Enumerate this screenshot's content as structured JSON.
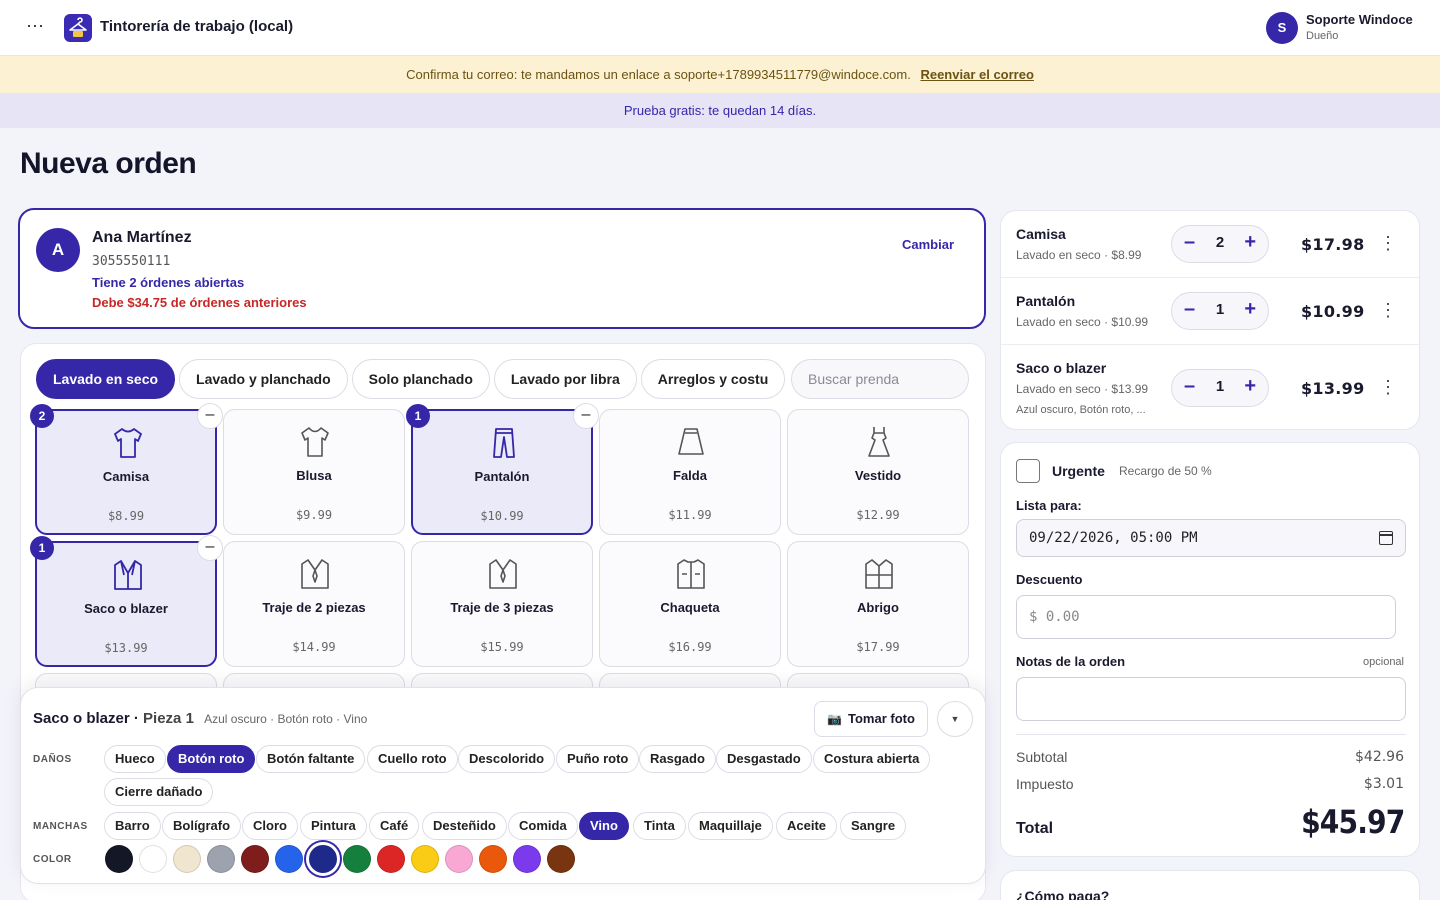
{
  "header": {
    "menu_icon": "more-horizontal-icon",
    "app_title": "Tintorería de trabajo (local)",
    "user": {
      "initial": "S",
      "name": "Soporte Windoce",
      "role": "Dueño"
    }
  },
  "banners": {
    "email_text": "Confirma tu correo: te mandamos un enlace a soporte+1789934511779@windoce.com.",
    "email_link": "Reenviar el correo",
    "trial_text": "Prueba gratis: te quedan 14 días."
  },
  "page": {
    "title": "Nueva orden"
  },
  "customer": {
    "initial": "A",
    "name": "Ana Martínez",
    "phone": "3055550111",
    "open_orders": "Tiene 2 órdenes abiertas",
    "debt": "Debe $34.75 de órdenes anteriores",
    "change": "Cambiar"
  },
  "catalog": {
    "tabs": [
      "Lavado en seco",
      "Lavado y planchado",
      "Solo planchado",
      "Lavado por libra",
      "Arreglos y costu"
    ],
    "active_tab": 0,
    "search_placeholder": "Buscar prenda",
    "items": [
      {
        "name": "Camisa",
        "price": "$8.99",
        "icon": "shirt-icon",
        "count": "2",
        "selected": true
      },
      {
        "name": "Blusa",
        "price": "$9.99",
        "icon": "blouse-icon",
        "selected": false
      },
      {
        "name": "Pantalón",
        "price": "$10.99",
        "icon": "pants-icon",
        "count": "1",
        "selected": true
      },
      {
        "name": "Falda",
        "price": "$11.99",
        "icon": "skirt-icon",
        "selected": false
      },
      {
        "name": "Vestido",
        "price": "$12.99",
        "icon": "dress-icon",
        "selected": false
      },
      {
        "name": "Saco o blazer",
        "price": "$13.99",
        "icon": "blazer-icon",
        "count": "1",
        "selected": true
      },
      {
        "name": "Traje de 2 piezas",
        "price": "$14.99",
        "icon": "suit-icon",
        "selected": false
      },
      {
        "name": "Traje de 3 piezas",
        "price": "$15.99",
        "icon": "suit-icon",
        "selected": false
      },
      {
        "name": "Chaqueta",
        "price": "$16.99",
        "icon": "jacket-icon",
        "selected": false
      },
      {
        "name": "Abrigo",
        "price": "$17.99",
        "icon": "coat-icon",
        "selected": false
      }
    ]
  },
  "detail": {
    "item": "Saco o blazer",
    "piece": "Pieza 1",
    "summary": "Azul oscuro · Botón roto · Vino",
    "photo_button": "Tomar foto",
    "damage_label": "DAÑOS",
    "damages": [
      {
        "label": "Hueco",
        "on": false
      },
      {
        "label": "Botón roto",
        "on": true
      },
      {
        "label": "Botón faltante",
        "on": false
      },
      {
        "label": "Cuello roto",
        "on": false
      },
      {
        "label": "Descolorido",
        "on": false
      },
      {
        "label": "Puño roto",
        "on": false
      },
      {
        "label": "Rasgado",
        "on": false
      },
      {
        "label": "Desgastado",
        "on": false
      },
      {
        "label": "Costura abierta",
        "on": false
      },
      {
        "label": "Cierre dañado",
        "on": false
      }
    ],
    "stain_label": "MANCHAS",
    "stains": [
      {
        "label": "Barro",
        "on": false
      },
      {
        "label": "Bolígrafo",
        "on": false
      },
      {
        "label": "Cloro",
        "on": false
      },
      {
        "label": "Pintura",
        "on": false
      },
      {
        "label": "Café",
        "on": false
      },
      {
        "label": "Desteñido",
        "on": false
      },
      {
        "label": "Comida",
        "on": false
      },
      {
        "label": "Vino",
        "on": true
      },
      {
        "label": "Tinta",
        "on": false
      },
      {
        "label": "Maquillaje",
        "on": false
      },
      {
        "label": "Aceite",
        "on": false
      },
      {
        "label": "Sangre",
        "on": false
      }
    ],
    "color_label": "COLOR",
    "colors": [
      "#141826",
      "#ffffff",
      "#f0e6cf",
      "#9ca3af",
      "#7f1d1d",
      "#2563eb",
      "#1e2a8a",
      "#15803d",
      "#dc2626",
      "#facc15",
      "#f9a8d4",
      "#ea580c",
      "#7c3aed",
      "#78350f"
    ],
    "selected_color": 6
  },
  "cart": [
    {
      "name": "Camisa",
      "sub": "Lavado en seco · $8.99",
      "qty": "2",
      "total": "$17.98",
      "note": ""
    },
    {
      "name": "Pantalón",
      "sub": "Lavado en seco · $10.99",
      "qty": "1",
      "total": "$10.99",
      "note": ""
    },
    {
      "name": "Saco o blazer",
      "sub": "Lavado en seco · $13.99",
      "qty": "1",
      "total": "$13.99",
      "note": "Azul oscuro, Botón roto, ..."
    }
  ],
  "summary": {
    "urgent_label": "Urgente",
    "urgent_sub": "Recargo de 50 %",
    "ready_label": "Lista para:",
    "ready_value": "09/22/2026, 05:00 PM",
    "discount_label": "Descuento",
    "discount_placeholder": "$ 0.00",
    "notes_label": "Notas de la orden",
    "notes_optional": "opcional",
    "subtotal_label": "Subtotal",
    "subtotal": "$42.96",
    "tax_label": "Impuesto",
    "tax": "$3.01",
    "total_label": "Total",
    "total": "$45.97"
  },
  "payment": {
    "title": "¿Cómo paga?"
  }
}
